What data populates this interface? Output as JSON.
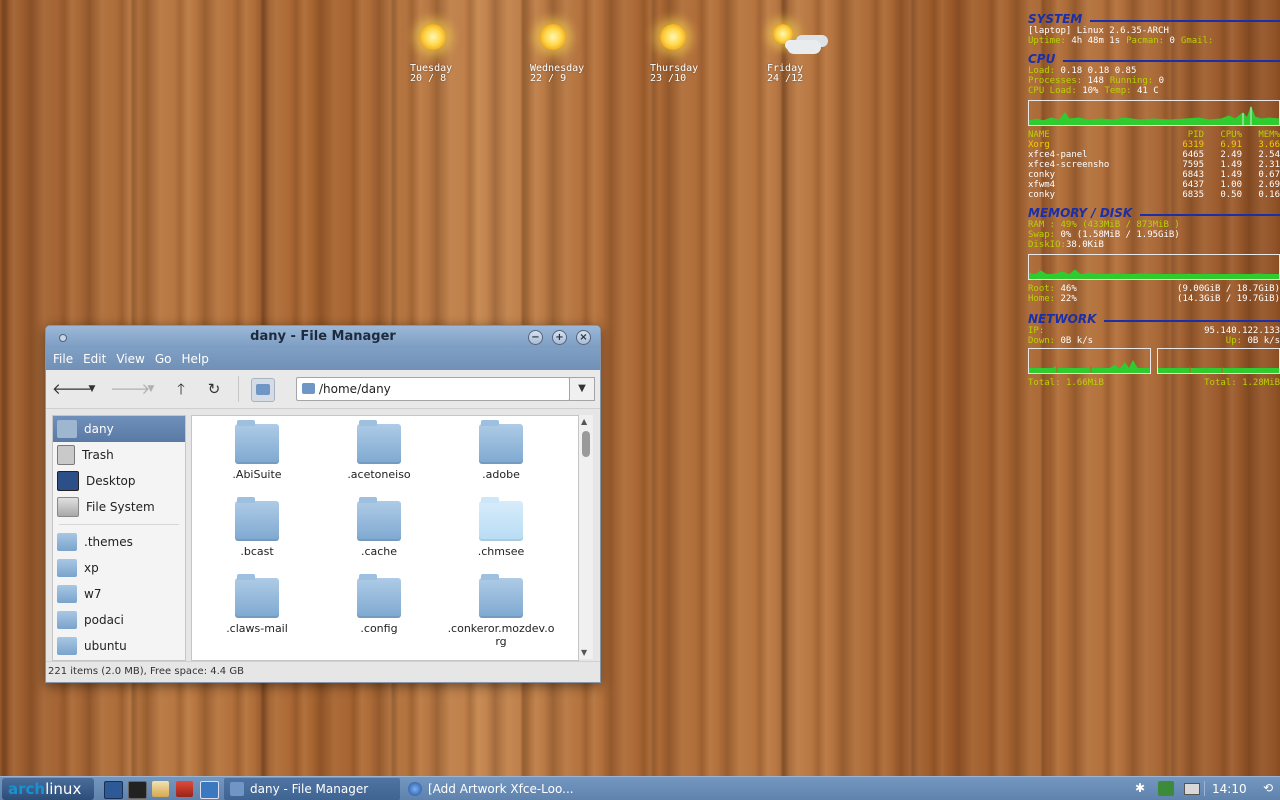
{
  "weather": [
    {
      "day": "Tuesday",
      "temps": "20 / 8",
      "icon": "sun-icon"
    },
    {
      "day": "Wednesday",
      "temps": "22 / 9",
      "icon": "sun-icon"
    },
    {
      "day": "Thursday",
      "temps": "23 /10",
      "icon": "sun-icon"
    },
    {
      "day": "Friday",
      "temps": "24 /12",
      "icon": "partly-cloudy-icon"
    }
  ],
  "conky": {
    "system": {
      "heading": "SYSTEM",
      "line1": "[laptop] Linux 2.6.35-ARCH",
      "uptime_label": "Uptime:",
      "uptime": "4h 48m 1s",
      "pacman_label": "Pacman:",
      "pacman": "0",
      "gmail_label": "Gmail:"
    },
    "cpu": {
      "heading": "CPU",
      "load_label": "Load:",
      "load": "0.18 0.18 0.85",
      "processes_label": "Processes:",
      "processes": "148",
      "running_label": "Running:",
      "running": "0",
      "cpuload_label": "CPU Load:",
      "cpuload": "10%",
      "temp_label": "Temp:",
      "temp": "41  C",
      "table_headers": [
        "NAME",
        "PID",
        "CPU%",
        "MEM%"
      ],
      "processes_table": [
        {
          "name": "Xorg",
          "pid": "6319",
          "cpu": "6.91",
          "mem": "3.66"
        },
        {
          "name": "xfce4-panel",
          "pid": "6465",
          "cpu": "2.49",
          "mem": "2.54"
        },
        {
          "name": "xfce4-screensho",
          "pid": "7595",
          "cpu": "1.49",
          "mem": "2.31"
        },
        {
          "name": "conky",
          "pid": "6843",
          "cpu": "1.49",
          "mem": "0.67"
        },
        {
          "name": "xfwm4",
          "pid": "6437",
          "cpu": "1.00",
          "mem": "2.69"
        },
        {
          "name": "conky",
          "pid": "6835",
          "cpu": "0.50",
          "mem": "0.16"
        }
      ]
    },
    "memory": {
      "heading": "MEMORY / DISK",
      "ram_label": "RAM :",
      "ram": "49% (433MiB  / 873MiB )",
      "swap_label": "Swap:",
      "swap": "0% (1.58MiB / 1.95GiB)",
      "diskio_label": "DiskIO:",
      "diskio": "38.0KiB",
      "root_label": "Root:",
      "root_pct": "46%",
      "root_size": "(9.00GiB / 18.7GiB)",
      "home_label": "Home:",
      "home_pct": "22%",
      "home_size": "(14.3GiB / 19.7GiB)"
    },
    "network": {
      "heading": "NETWORK",
      "ip_label": "IP:",
      "ip": "95.140.122.133",
      "down_label": "Down:",
      "down": "0B    k/s",
      "up_label": "Up:",
      "up": "0B    k/s",
      "total_down_label": "Total:",
      "total_down": "1.66MiB",
      "total_up_label": "Total:",
      "total_up": "1.28MiB"
    }
  },
  "file_manager": {
    "title": "dany - File Manager",
    "menu": [
      "File",
      "Edit",
      "View",
      "Go",
      "Help"
    ],
    "path": "/home/dany",
    "sidebar": [
      {
        "label": "dany",
        "icon": "home-folder-icon",
        "selected": true
      },
      {
        "label": "Trash",
        "icon": "trash-icon"
      },
      {
        "label": "Desktop",
        "icon": "desktop-icon"
      },
      {
        "label": "File System",
        "icon": "drive-icon"
      },
      {
        "label": ".themes",
        "icon": "folder-icon"
      },
      {
        "label": "xp",
        "icon": "folder-icon"
      },
      {
        "label": "w7",
        "icon": "folder-icon"
      },
      {
        "label": "podaci",
        "icon": "folder-icon"
      },
      {
        "label": "ubuntu",
        "icon": "folder-icon"
      }
    ],
    "folders": [
      ".AbiSuite",
      ".acetoneiso",
      ".adobe",
      ".bcast",
      ".cache",
      ".chmsee",
      ".claws-mail",
      ".config",
      ".conkeror.mozdev.o rg"
    ],
    "status": "221 items (2.0 MB), Free space: 4.4 GB"
  },
  "taskbar": {
    "logo_a": "arch",
    "logo_b": "linux",
    "tasks": [
      "dany - File Manager",
      "[Add  Artwork Xfce-Loo..."
    ],
    "clock": "14:10"
  }
}
